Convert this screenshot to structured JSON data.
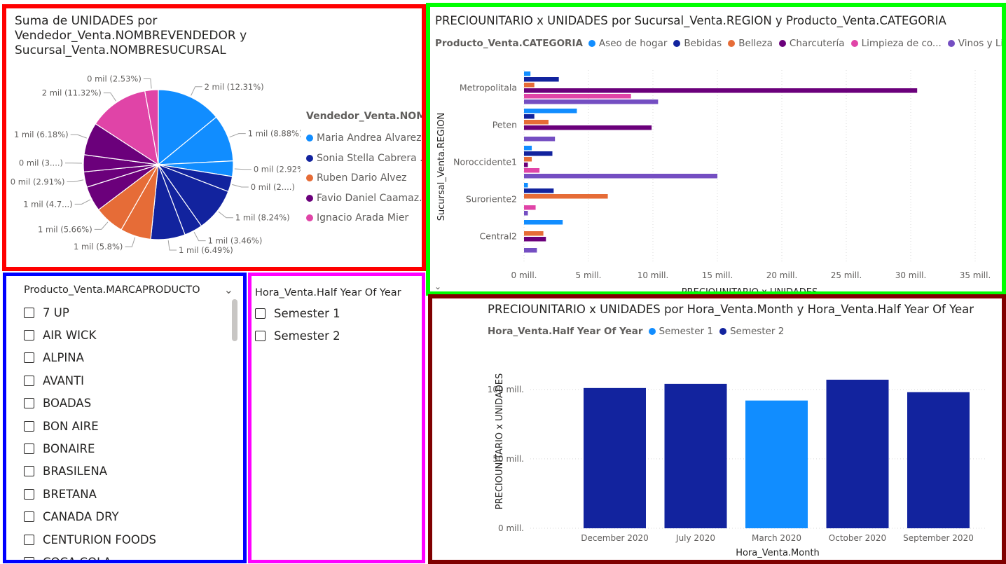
{
  "pie_panel": {
    "title_lines": [
      "Suma de UNIDADES por",
      "Vendedor_Venta.NOMBREVENDEDOR y",
      "Sucursal_Venta.NOMBRESUCURSAL"
    ],
    "legend_title": "Vendedor_Venta.NOM...",
    "legend": [
      {
        "label": "Maria Andrea Alvarez...",
        "color": "#118dff"
      },
      {
        "label": "Sonia Stella Cabrera ...",
        "color": "#12239e"
      },
      {
        "label": "Ruben Dario Alvez",
        "color": "#e66c37"
      },
      {
        "label": "Favio Daniel Caamaz...",
        "color": "#6b007b"
      },
      {
        "label": "Ignacio Arada Mier",
        "color": "#e044a7"
      }
    ]
  },
  "region_panel": {
    "title": "PRECIOUNITARIO x UNIDADES por Sucursal_Venta.REGION y Producto_Venta.CATEGORIA",
    "legend_title": "Producto_Venta.CATEGORIA",
    "legend": [
      {
        "label": "Aseo de hogar",
        "color": "#118dff"
      },
      {
        "label": "Bebidas",
        "color": "#12239e"
      },
      {
        "label": "Belleza",
        "color": "#e66c37"
      },
      {
        "label": "Charcutería",
        "color": "#6b007b"
      },
      {
        "label": "Limpieza de co...",
        "color": "#e044a7"
      },
      {
        "label": "Vinos y Licor...",
        "color": "#744ec2"
      }
    ]
  },
  "brand_slicer": {
    "header": "Producto_Venta.MARCAPRODUCTO",
    "items": [
      "7 UP",
      "AIR WICK",
      "ALPINA",
      "AVANTI",
      "BOADAS",
      "BON AIRE",
      "BONAIRE",
      "BRASILENA",
      "BRETANA",
      "CANADA DRY",
      "CENTURION FOODS",
      "COCA COLA"
    ]
  },
  "half_slicer": {
    "header": "Hora_Venta.Half Year Of Year",
    "items": [
      "Semester 1",
      "Semester 2"
    ]
  },
  "month_panel": {
    "title": "PRECIOUNITARIO x UNIDADES por Hora_Venta.Month y Hora_Venta.Half Year Of Year",
    "legend_title": "Hora_Venta.Half Year Of Year",
    "legend": [
      {
        "label": "Semester 1",
        "color": "#118dff"
      },
      {
        "label": "Semester 2",
        "color": "#12239e"
      }
    ]
  },
  "chart_data": [
    {
      "type": "pie",
      "title": "Suma de UNIDADES por Vendedor_Venta.NOMBREVENDEDOR y Sucursal_Venta.NOMBRESUCURSAL",
      "slices": [
        {
          "label": "2 mil (12.31%)",
          "value": 12.31,
          "group": 0
        },
        {
          "label": "1 mil (8.88%)",
          "value": 8.88,
          "group": 0
        },
        {
          "label": "0 mil (2.92%)",
          "value": 2.92,
          "group": 0
        },
        {
          "label": "0 mil (2....)",
          "value": 2.9,
          "group": 1
        },
        {
          "label": "1 mil (8.24%)",
          "value": 8.24,
          "group": 1
        },
        {
          "label": "1 mil (3.46%)",
          "value": 3.46,
          "group": 1
        },
        {
          "label": "1 mil (6.49%)",
          "value": 6.49,
          "group": 1
        },
        {
          "label": "1 mil (5.8%)",
          "value": 5.8,
          "group": 2
        },
        {
          "label": "1 mil (5.66%)",
          "value": 5.66,
          "group": 2
        },
        {
          "label": "1 mil (4.7...)",
          "value": 4.75,
          "group": 3
        },
        {
          "label": "0 mil (2.91%)",
          "value": 2.91,
          "group": 3
        },
        {
          "label": "0 mil (3....)",
          "value": 3.2,
          "group": 3
        },
        {
          "label": "1 mil (6.18%)",
          "value": 6.18,
          "group": 3
        },
        {
          "label": "2 mil (11.32%)",
          "value": 11.32,
          "group": 4
        },
        {
          "label": "0 mil (2.53%)",
          "value": 2.53,
          "group": 4
        }
      ]
    },
    {
      "type": "bar",
      "orientation": "horizontal",
      "title": "PRECIOUNITARIO x UNIDADES por Sucursal_Venta.REGION y Producto_Venta.CATEGORIA",
      "xlabel": "PRECIOUNITARIO x UNIDADES",
      "ylabel": "Sucursal_Venta.REGION",
      "categories": [
        "Metropolitala",
        "Peten",
        "Noroccidente1",
        "Suroriente2",
        "Central2"
      ],
      "xlim": [
        0,
        35
      ],
      "xticks": [
        "0 mill.",
        "5 mill.",
        "10 mill.",
        "15 mill.",
        "20 mill.",
        "25 mill.",
        "30 mill.",
        "35 mill."
      ],
      "series": [
        {
          "name": "Aseo de hogar",
          "values": [
            0.5,
            4.1,
            0.6,
            0.3,
            3.0
          ]
        },
        {
          "name": "Bebidas",
          "values": [
            2.7,
            0.8,
            2.2,
            2.3,
            null
          ]
        },
        {
          "name": "Belleza",
          "values": [
            0.8,
            1.9,
            0.6,
            6.5,
            1.5
          ]
        },
        {
          "name": "Charcutería",
          "values": [
            30.5,
            9.9,
            0.3,
            null,
            1.7
          ]
        },
        {
          "name": "Limpieza de co...",
          "values": [
            8.3,
            null,
            1.2,
            0.9,
            null
          ]
        },
        {
          "name": "Vinos y Licor...",
          "values": [
            10.4,
            2.4,
            15.0,
            0.3,
            1.0
          ]
        }
      ]
    },
    {
      "type": "bar",
      "title": "PRECIOUNITARIO x UNIDADES por Hora_Venta.Month y Hora_Venta.Half Year Of Year",
      "xlabel": "Hora_Venta.Month",
      "ylabel": "PRECIOUNITARIO x UNIDADES",
      "categories": [
        "December 2020",
        "July 2020",
        "March 2020",
        "October 2020",
        "September 2020"
      ],
      "ylim": [
        0,
        120
      ],
      "yticks": [
        "0 mill.",
        "50 mill.",
        "100 mill."
      ],
      "series": [
        {
          "name": "Semester 2",
          "values": [
            101,
            104,
            null,
            107,
            98
          ]
        },
        {
          "name": "Semester 1",
          "values": [
            null,
            null,
            92,
            null,
            null
          ]
        }
      ]
    }
  ]
}
